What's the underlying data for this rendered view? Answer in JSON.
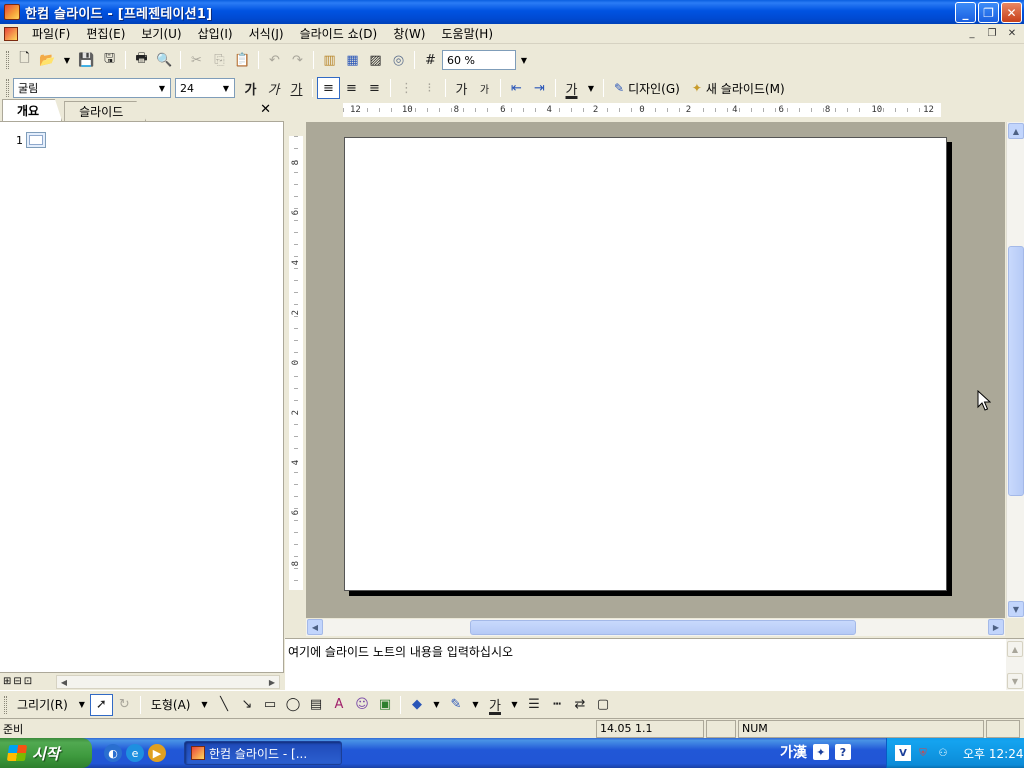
{
  "window": {
    "title": "한컴 슬라이드 - [프레젠테이션1]",
    "controls": {
      "minimize": "_",
      "maximize": "❐",
      "close": "✕"
    }
  },
  "menu": {
    "items": [
      "파일(F)",
      "편집(E)",
      "보기(U)",
      "삽입(I)",
      "서식(J)",
      "슬라이드 쇼(D)",
      "창(W)",
      "도움말(H)"
    ],
    "mdi": {
      "minimize": "_",
      "restore": "❐",
      "close": "✕"
    }
  },
  "standard_toolbar": {
    "zoom": "60 %"
  },
  "format_toolbar": {
    "font": "굴림",
    "size": "24",
    "bold_label": "가",
    "italic_label": "가",
    "underline_label": "가",
    "superscript_label": "가",
    "subscript_label": "가",
    "font_color_label": "가",
    "design_label": "디자인(G)",
    "new_slide_label": "새 슬라이드(M)"
  },
  "left_panel": {
    "tabs": [
      {
        "label": "개요",
        "active": true
      },
      {
        "label": "슬라이드",
        "active": false
      }
    ],
    "close": "✕",
    "outline_number": "1"
  },
  "rulers": {
    "horizontal": [
      "12",
      "10",
      "8",
      "6",
      "4",
      "2",
      "0",
      "2",
      "4",
      "6",
      "8",
      "10",
      "12"
    ],
    "vertical": [
      "8",
      "6",
      "4",
      "2",
      "0",
      "2",
      "4",
      "6",
      "8"
    ]
  },
  "notes": {
    "placeholder": "여기에 슬라이드 노트의 내용을 입력하십시오"
  },
  "drawing_toolbar": {
    "draw_label": "그리기(R)",
    "shapes_label": "도형(A)",
    "font_color_label": "가"
  },
  "status_bar": {
    "state": "준비",
    "position": "14.05 1.1",
    "num": "NUM"
  },
  "taskbar": {
    "start_label": "시작",
    "task_label": "한컴 슬라이드 - [...",
    "ime_label": "가漢",
    "clock": "오후 12:24"
  }
}
